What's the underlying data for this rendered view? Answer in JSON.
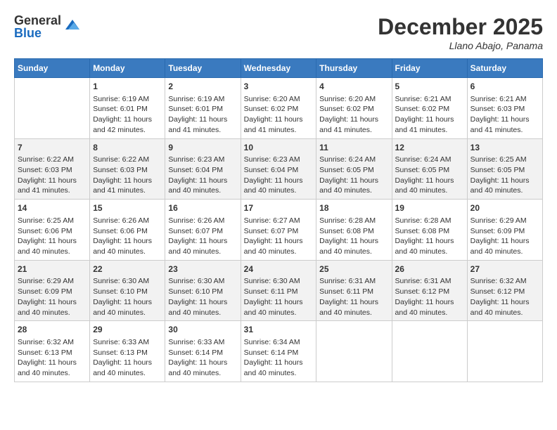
{
  "logo": {
    "general": "General",
    "blue": "Blue"
  },
  "title": "December 2025",
  "location": "Llano Abajo, Panama",
  "days_header": [
    "Sunday",
    "Monday",
    "Tuesday",
    "Wednesday",
    "Thursday",
    "Friday",
    "Saturday"
  ],
  "weeks": [
    [
      {
        "day": "",
        "info": ""
      },
      {
        "day": "1",
        "info": "Sunrise: 6:19 AM\nSunset: 6:01 PM\nDaylight: 11 hours and 42 minutes."
      },
      {
        "day": "2",
        "info": "Sunrise: 6:19 AM\nSunset: 6:01 PM\nDaylight: 11 hours and 41 minutes."
      },
      {
        "day": "3",
        "info": "Sunrise: 6:20 AM\nSunset: 6:02 PM\nDaylight: 11 hours and 41 minutes."
      },
      {
        "day": "4",
        "info": "Sunrise: 6:20 AM\nSunset: 6:02 PM\nDaylight: 11 hours and 41 minutes."
      },
      {
        "day": "5",
        "info": "Sunrise: 6:21 AM\nSunset: 6:02 PM\nDaylight: 11 hours and 41 minutes."
      },
      {
        "day": "6",
        "info": "Sunrise: 6:21 AM\nSunset: 6:03 PM\nDaylight: 11 hours and 41 minutes."
      }
    ],
    [
      {
        "day": "7",
        "info": "Sunrise: 6:22 AM\nSunset: 6:03 PM\nDaylight: 11 hours and 41 minutes."
      },
      {
        "day": "8",
        "info": "Sunrise: 6:22 AM\nSunset: 6:03 PM\nDaylight: 11 hours and 41 minutes."
      },
      {
        "day": "9",
        "info": "Sunrise: 6:23 AM\nSunset: 6:04 PM\nDaylight: 11 hours and 40 minutes."
      },
      {
        "day": "10",
        "info": "Sunrise: 6:23 AM\nSunset: 6:04 PM\nDaylight: 11 hours and 40 minutes."
      },
      {
        "day": "11",
        "info": "Sunrise: 6:24 AM\nSunset: 6:05 PM\nDaylight: 11 hours and 40 minutes."
      },
      {
        "day": "12",
        "info": "Sunrise: 6:24 AM\nSunset: 6:05 PM\nDaylight: 11 hours and 40 minutes."
      },
      {
        "day": "13",
        "info": "Sunrise: 6:25 AM\nSunset: 6:05 PM\nDaylight: 11 hours and 40 minutes."
      }
    ],
    [
      {
        "day": "14",
        "info": "Sunrise: 6:25 AM\nSunset: 6:06 PM\nDaylight: 11 hours and 40 minutes."
      },
      {
        "day": "15",
        "info": "Sunrise: 6:26 AM\nSunset: 6:06 PM\nDaylight: 11 hours and 40 minutes."
      },
      {
        "day": "16",
        "info": "Sunrise: 6:26 AM\nSunset: 6:07 PM\nDaylight: 11 hours and 40 minutes."
      },
      {
        "day": "17",
        "info": "Sunrise: 6:27 AM\nSunset: 6:07 PM\nDaylight: 11 hours and 40 minutes."
      },
      {
        "day": "18",
        "info": "Sunrise: 6:28 AM\nSunset: 6:08 PM\nDaylight: 11 hours and 40 minutes."
      },
      {
        "day": "19",
        "info": "Sunrise: 6:28 AM\nSunset: 6:08 PM\nDaylight: 11 hours and 40 minutes."
      },
      {
        "day": "20",
        "info": "Sunrise: 6:29 AM\nSunset: 6:09 PM\nDaylight: 11 hours and 40 minutes."
      }
    ],
    [
      {
        "day": "21",
        "info": "Sunrise: 6:29 AM\nSunset: 6:09 PM\nDaylight: 11 hours and 40 minutes."
      },
      {
        "day": "22",
        "info": "Sunrise: 6:30 AM\nSunset: 6:10 PM\nDaylight: 11 hours and 40 minutes."
      },
      {
        "day": "23",
        "info": "Sunrise: 6:30 AM\nSunset: 6:10 PM\nDaylight: 11 hours and 40 minutes."
      },
      {
        "day": "24",
        "info": "Sunrise: 6:30 AM\nSunset: 6:11 PM\nDaylight: 11 hours and 40 minutes."
      },
      {
        "day": "25",
        "info": "Sunrise: 6:31 AM\nSunset: 6:11 PM\nDaylight: 11 hours and 40 minutes."
      },
      {
        "day": "26",
        "info": "Sunrise: 6:31 AM\nSunset: 6:12 PM\nDaylight: 11 hours and 40 minutes."
      },
      {
        "day": "27",
        "info": "Sunrise: 6:32 AM\nSunset: 6:12 PM\nDaylight: 11 hours and 40 minutes."
      }
    ],
    [
      {
        "day": "28",
        "info": "Sunrise: 6:32 AM\nSunset: 6:13 PM\nDaylight: 11 hours and 40 minutes."
      },
      {
        "day": "29",
        "info": "Sunrise: 6:33 AM\nSunset: 6:13 PM\nDaylight: 11 hours and 40 minutes."
      },
      {
        "day": "30",
        "info": "Sunrise: 6:33 AM\nSunset: 6:14 PM\nDaylight: 11 hours and 40 minutes."
      },
      {
        "day": "31",
        "info": "Sunrise: 6:34 AM\nSunset: 6:14 PM\nDaylight: 11 hours and 40 minutes."
      },
      {
        "day": "",
        "info": ""
      },
      {
        "day": "",
        "info": ""
      },
      {
        "day": "",
        "info": ""
      }
    ]
  ]
}
